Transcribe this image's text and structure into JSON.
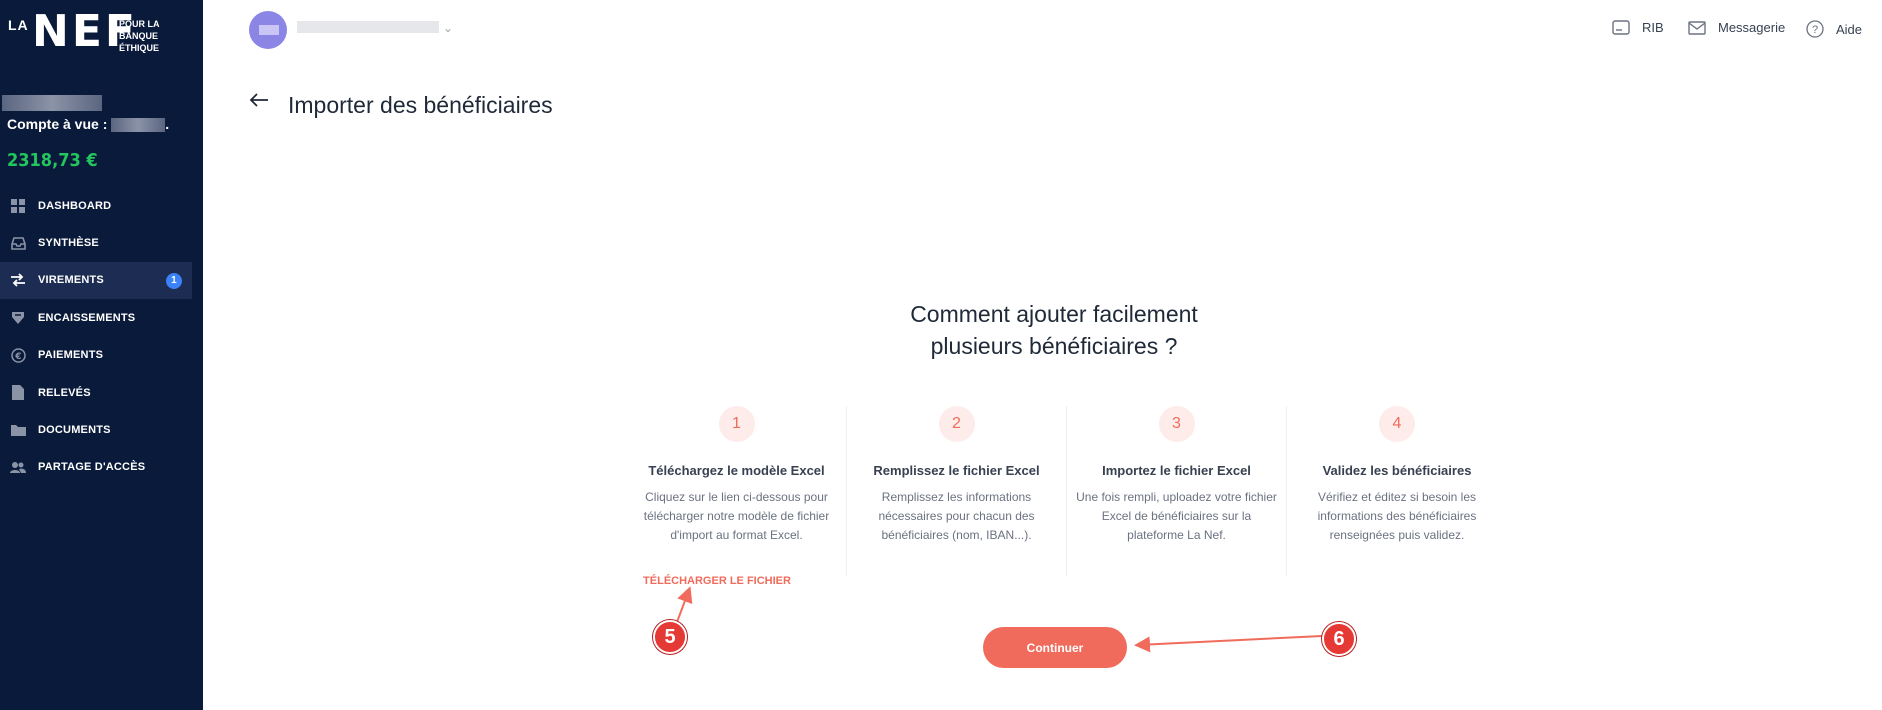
{
  "sidebar": {
    "logo": {
      "la": "LA",
      "nef": "NEF",
      "tagline": [
        "POUR LA",
        "BANQUE",
        "ÉTHIQUE"
      ]
    },
    "account_label": "Compte à vue : ",
    "account_suffix": ".",
    "balance": "2318,73 €",
    "items": [
      {
        "label": "DASHBOARD",
        "icon": "grid-icon",
        "active": false
      },
      {
        "label": "SYNTHÈSE",
        "icon": "inbox-icon",
        "active": false
      },
      {
        "label": "VIREMENTS",
        "icon": "transfer-arrows-icon",
        "active": true,
        "badge": "1"
      },
      {
        "label": "ENCAISSEMENTS",
        "icon": "collection-icon",
        "active": false
      },
      {
        "label": "PAIEMENTS",
        "icon": "euro-icon",
        "active": false
      },
      {
        "label": "RELEVÉS",
        "icon": "document-icon",
        "active": false
      },
      {
        "label": "DOCUMENTS",
        "icon": "folder-icon",
        "active": false
      },
      {
        "label": "PARTAGE D'ACCÈS",
        "icon": "users-icon",
        "active": false
      }
    ]
  },
  "topbar": {
    "links": [
      {
        "label": "RIB",
        "icon": "card-icon"
      },
      {
        "label": "Messagerie",
        "icon": "mail-icon"
      },
      {
        "label": "Aide",
        "icon": "help-icon"
      }
    ]
  },
  "page": {
    "title": "Importer des bénéficiaires",
    "headline_line1": "Comment ajouter facilement",
    "headline_line2": "plusieurs bénéficiaires ?",
    "steps": [
      {
        "num": "1",
        "title": "Téléchargez le modèle Excel",
        "desc": "Cliquez sur le lien ci-dessous pour télécharger notre modèle de fichier d'import au format Excel."
      },
      {
        "num": "2",
        "title": "Remplissez le fichier Excel",
        "desc": "Remplissez les informations nécessaires pour chacun des bénéficiaires (nom, IBAN...)."
      },
      {
        "num": "3",
        "title": "Importez le fichier Excel",
        "desc": "Une fois rempli, uploadez votre fichier Excel de bénéficiaires sur la plateforme La Nef."
      },
      {
        "num": "4",
        "title": "Validez les bénéficiaires",
        "desc": "Vérifiez et éditez si besoin les informations des bénéficiaires renseignées puis validez."
      }
    ],
    "download_link": "TÉLÉCHARGER LE FICHIER",
    "continue_button": "Continuer"
  },
  "annotations": {
    "marker_5": "5",
    "marker_6": "6"
  },
  "colors": {
    "sidebar": "#0a1a3a",
    "accent": "#f06b5b",
    "balance": "#22c55e",
    "badge": "#3b82f6"
  }
}
